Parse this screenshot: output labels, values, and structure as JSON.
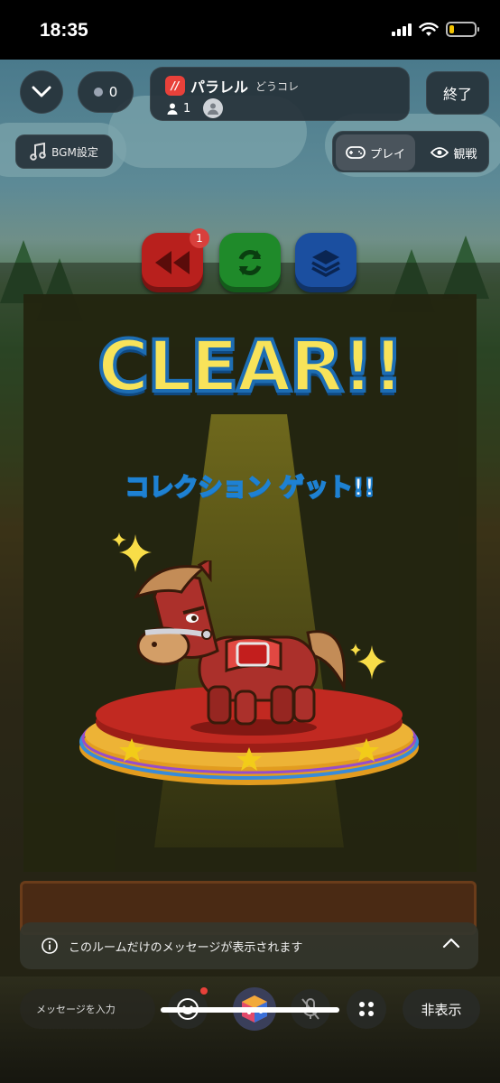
{
  "status": {
    "time": "18:35"
  },
  "header": {
    "viewer_count": "0",
    "app_name": "パラレル",
    "room_name": "どうコレ",
    "member_count": "1",
    "end_label": "終了"
  },
  "toolbar": {
    "bgm_label": "BGM設定",
    "play_label": "プレイ",
    "watch_label": "観戦"
  },
  "game": {
    "rewind_badge": "1",
    "clear_title": "CLEAR!!",
    "collection_text": "コレクション ゲット!!"
  },
  "chat": {
    "notice": "このルームだけのメッセージが表示されます",
    "input_placeholder": "メッセージを入力",
    "hide_label": "非表示"
  }
}
